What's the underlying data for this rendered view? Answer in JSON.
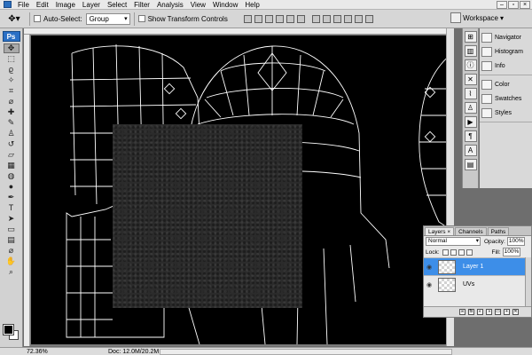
{
  "menu": {
    "items": [
      "File",
      "Edit",
      "Image",
      "Layer",
      "Select",
      "Filter",
      "Analysis",
      "View",
      "Window",
      "Help"
    ]
  },
  "options_bar": {
    "auto_select_label": "Auto-Select:",
    "auto_select_value": "Group",
    "show_transform_label": "Show Transform Controls",
    "workspace_label": "Workspace",
    "workspace_arrow": "▾"
  },
  "toolbox": {
    "badge": "Ps",
    "tools": [
      {
        "name": "move-tool",
        "glyph": "✥",
        "active": true
      },
      {
        "name": "marquee-tool",
        "glyph": "⬚"
      },
      {
        "name": "lasso-tool",
        "glyph": "ϱ"
      },
      {
        "name": "magic-wand-tool",
        "glyph": "✧"
      },
      {
        "name": "crop-tool",
        "glyph": "⌗"
      },
      {
        "name": "eyedropper-tool",
        "glyph": "⌀"
      },
      {
        "name": "healing-tool",
        "glyph": "✚"
      },
      {
        "name": "brush-tool",
        "glyph": "✎"
      },
      {
        "name": "clone-stamp-tool",
        "glyph": "♙"
      },
      {
        "name": "history-brush-tool",
        "glyph": "↺"
      },
      {
        "name": "eraser-tool",
        "glyph": "▱"
      },
      {
        "name": "gradient-tool",
        "glyph": "▦"
      },
      {
        "name": "blur-tool",
        "glyph": "◍"
      },
      {
        "name": "dodge-tool",
        "glyph": "●"
      },
      {
        "name": "pen-tool",
        "glyph": "✒"
      },
      {
        "name": "type-tool",
        "glyph": "T"
      },
      {
        "name": "path-selection-tool",
        "glyph": "➤"
      },
      {
        "name": "shape-tool",
        "glyph": "▭"
      },
      {
        "name": "notes-tool",
        "glyph": "▤"
      },
      {
        "name": "eyedropper-2-tool",
        "glyph": "⌀"
      },
      {
        "name": "hand-tool",
        "glyph": "✋"
      },
      {
        "name": "zoom-tool",
        "glyph": "⌕"
      }
    ]
  },
  "status": {
    "zoom": "72.36%",
    "doc_size": "Doc: 12.0M/20.2M",
    "doc_arrow": "▸"
  },
  "dock": {
    "groups": [
      [
        "Navigator",
        "Histogram",
        "Info"
      ],
      [
        "Color",
        "Swatches",
        "Styles"
      ]
    ]
  },
  "layers_panel": {
    "tabs": [
      "Layers ×",
      "Channels",
      "Paths"
    ],
    "blend_mode": "Normal",
    "opacity_label": "Opacity:",
    "opacity_value": "100%",
    "lock_label": "Lock:",
    "fill_label": "Fill:",
    "fill_value": "100%",
    "layers": [
      {
        "name": "Layer 1",
        "selected": true
      },
      {
        "name": "UVs",
        "selected": false
      }
    ]
  },
  "colors": {
    "accent_selected": "#3d8ee8",
    "canvas": "#000000",
    "wireframe": "#ffffff"
  }
}
